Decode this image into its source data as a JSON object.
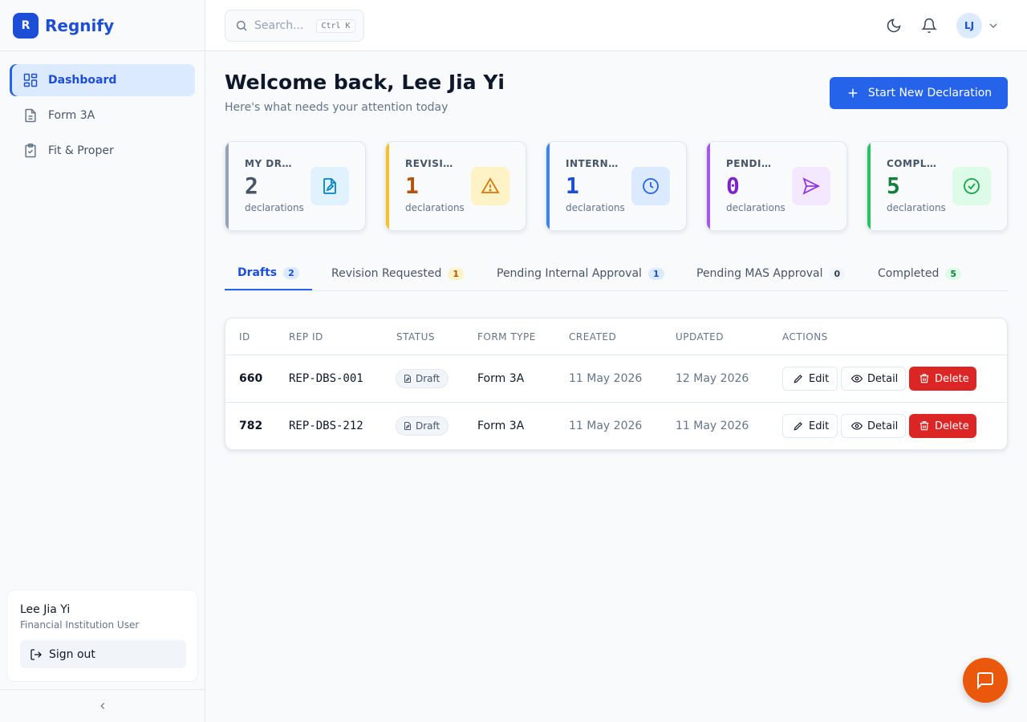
{
  "brand": {
    "logo_letter": "R",
    "name": "Regnify"
  },
  "sidebar": {
    "items": [
      {
        "label": "Dashboard",
        "icon": "dashboard-icon",
        "active": true
      },
      {
        "label": "Form 3A",
        "icon": "document-icon",
        "active": false
      },
      {
        "label": "Fit & Proper",
        "icon": "clipboard-check-icon",
        "active": false
      }
    ],
    "user": {
      "name": "Lee Jia Yi",
      "role": "Financial Institution User"
    },
    "signout_label": "Sign out"
  },
  "topbar": {
    "search_placeholder": "Search...",
    "search_shortcut": "Ctrl K",
    "avatar_initials": "LJ"
  },
  "header": {
    "title": "Welcome back, Lee Jia Yi",
    "subtitle": "Here's what needs your attention today",
    "new_button": "Start New Declaration"
  },
  "stats": [
    {
      "label": "MY DRAFTS",
      "count": "2",
      "unit": "declarations",
      "accent": "#94a3b8",
      "count_color": "#475569",
      "icon_bg": "#e0f2fe",
      "icon": "file-edit-icon",
      "icon_color": "#0284c7"
    },
    {
      "label": "REVISION REQUESTED",
      "count": "1",
      "unit": "declarations",
      "accent": "#fbbf24",
      "count_color": "#b45309",
      "icon_bg": "#fef3c7",
      "icon": "warning-icon",
      "icon_color": "#d97706"
    },
    {
      "label": "INTERNAL APPROVAL",
      "count": "1",
      "unit": "declarations",
      "accent": "#3b82f6",
      "count_color": "#1d4ed8",
      "icon_bg": "#dbeafe",
      "icon": "clock-icon",
      "icon_color": "#2563eb"
    },
    {
      "label": "PENDING MAS",
      "count": "0",
      "unit": "declarations",
      "accent": "#a855f7",
      "count_color": "#7e22ce",
      "icon_bg": "#f3e8ff",
      "icon": "send-icon",
      "icon_color": "#9333ea"
    },
    {
      "label": "COMPLETED",
      "count": "5",
      "unit": "declarations",
      "accent": "#22c55e",
      "count_color": "#15803d",
      "icon_bg": "#dcfce7",
      "icon": "check-circle-icon",
      "icon_color": "#16a34a"
    }
  ],
  "tabs": [
    {
      "label": "Drafts",
      "count": "2",
      "badge_bg": "#dbeafe",
      "badge_color": "#1d4ed8",
      "active": true
    },
    {
      "label": "Revision Requested",
      "count": "1",
      "badge_bg": "#fef3c7",
      "badge_color": "#b45309",
      "active": false
    },
    {
      "label": "Pending Internal Approval",
      "count": "1",
      "badge_bg": "#dbeafe",
      "badge_color": "#1d4ed8",
      "active": false
    },
    {
      "label": "Pending MAS Approval",
      "count": "0",
      "badge_bg": "#f1f5f9",
      "badge_color": "#334155",
      "active": false
    },
    {
      "label": "Completed",
      "count": "5",
      "badge_bg": "#dcfce7",
      "badge_color": "#15803d",
      "active": false
    }
  ],
  "table": {
    "columns": [
      "ID",
      "REP ID",
      "STATUS",
      "FORM TYPE",
      "CREATED",
      "UPDATED",
      "ACTIONS"
    ],
    "rows": [
      {
        "id": "660",
        "rep_id": "REP-DBS-001",
        "status": "Draft",
        "form_type": "Form 3A",
        "created": "11 May 2026",
        "updated": "12 May 2026"
      },
      {
        "id": "782",
        "rep_id": "REP-DBS-212",
        "status": "Draft",
        "form_type": "Form 3A",
        "created": "11 May 2026",
        "updated": "11 May 2026"
      }
    ],
    "actions": {
      "edit": "Edit",
      "detail": "Detail",
      "delete": "Delete"
    }
  },
  "colors": {
    "primary": "#2563eb",
    "danger": "#dc2626",
    "chat_fab": "#ea580c"
  }
}
